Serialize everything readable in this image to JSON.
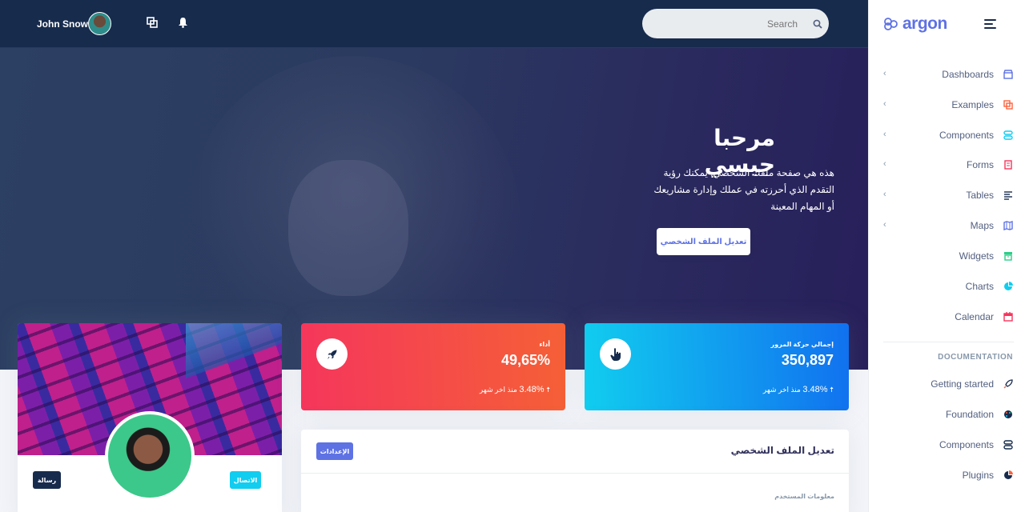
{
  "topbar": {
    "user_name": "John Snow",
    "search_placeholder": "Search",
    "icons": [
      "avatar",
      "screens-icon",
      "bell-icon",
      "search-icon"
    ]
  },
  "hero": {
    "title": "مرحبا جيسي",
    "text": "هذه هي صفحة ملفك الشخصي. يمكنك رؤية التقدم الذي أحرزته في عملك وإدارة مشاريعك أو المهام المعينة",
    "button_label": "تعديل الملف الشخصي"
  },
  "profile_card": {
    "connect_label": "الاتصال",
    "message_label": "رسالة"
  },
  "stats": [
    {
      "label": "أداء",
      "value": "49,65%",
      "change": "3.48%",
      "since": "منذ اخر شهر",
      "icon": "rocket-icon",
      "colors": [
        "#f5365c",
        "#f56036"
      ]
    },
    {
      "label": "إجمالي حركة المرور",
      "value": "350,897",
      "change": "3.48%",
      "since": "منذ اخر شهر",
      "icon": "hand-pointer-icon",
      "colors": [
        "#11cdef",
        "#1171ef"
      ]
    }
  ],
  "edit_card": {
    "title": "تعديل الملف الشخصي",
    "settings_label": "الإعدادات",
    "user_info_label": "معلومات المستخدم"
  },
  "sidebar": {
    "brand": "argon",
    "items": [
      {
        "label": "Dashboards",
        "icon": "shop-icon",
        "color": "#5e72e4",
        "expandable": true
      },
      {
        "label": "Examples",
        "icon": "ungroup-icon",
        "color": "#fb6340",
        "expandable": true
      },
      {
        "label": "Components",
        "icon": "ui-04-icon",
        "color": "#11cdef",
        "expandable": true
      },
      {
        "label": "Forms",
        "icon": "single-copy-icon",
        "color": "#f5365c",
        "expandable": true
      },
      {
        "label": "Tables",
        "icon": "align-left-icon",
        "color": "#172b4d",
        "expandable": true
      },
      {
        "label": "Maps",
        "icon": "map-big-icon",
        "color": "#5e72e4",
        "expandable": true
      },
      {
        "label": "Widgets",
        "icon": "archive-icon",
        "color": "#2dce89",
        "expandable": false
      },
      {
        "label": "Charts",
        "icon": "chart-pie-icon",
        "color": "#11cdef",
        "expandable": false
      },
      {
        "label": "Calendar",
        "icon": "calendar-icon",
        "color": "#f5365c",
        "expandable": false
      }
    ],
    "documentation_heading": "DOCUMENTATION",
    "doc_items": [
      {
        "label": "Getting started",
        "icon": "spaceship-icon"
      },
      {
        "label": "Foundation",
        "icon": "palette-icon"
      },
      {
        "label": "Components",
        "icon": "ui-04-icon"
      },
      {
        "label": "Plugins",
        "icon": "chart-pie-icon"
      }
    ]
  }
}
